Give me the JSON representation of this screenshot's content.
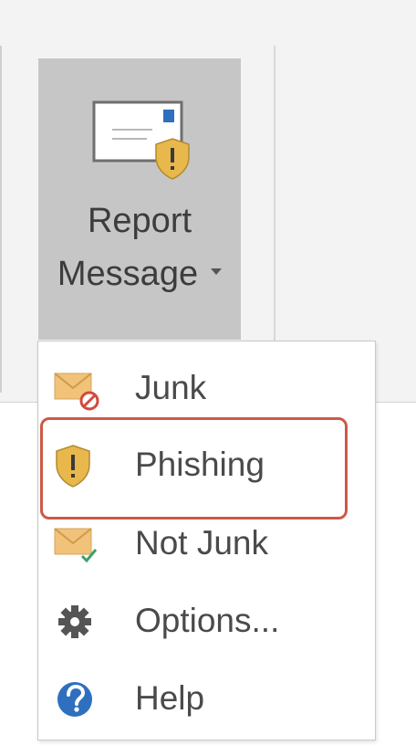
{
  "ribbon": {
    "report_button": {
      "line1": "Report",
      "line2": "Message",
      "icon": "report-message-icon"
    }
  },
  "menu": {
    "items": [
      {
        "label": "Junk",
        "icon": "envelope-block-icon"
      },
      {
        "label": "Phishing",
        "icon": "shield-warning-icon",
        "highlighted": true
      },
      {
        "label": "Not Junk",
        "icon": "envelope-check-icon"
      },
      {
        "label": "Options...",
        "icon": "gear-icon"
      },
      {
        "label": "Help",
        "icon": "help-icon"
      }
    ]
  },
  "colors": {
    "button_bg": "#c6c6c6",
    "highlight_border": "#cc5a46",
    "envelope": "#f0c27a",
    "shield": "#e8b84d",
    "help_blue": "#2f6fbf"
  }
}
